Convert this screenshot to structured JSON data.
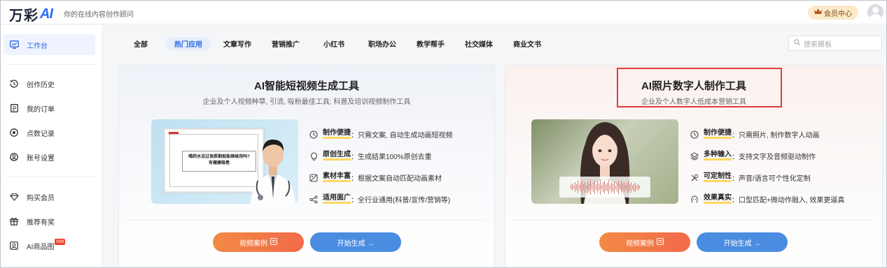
{
  "header": {
    "logo_text": "万彩",
    "logo_mark": "AI",
    "slogan": "你的在线内容创作顾问",
    "vip_label": "会员中心"
  },
  "sidebar": {
    "items": [
      {
        "label": "工作台",
        "icon": "monitor-chart-icon"
      },
      {
        "label": "创作历史",
        "icon": "history-icon"
      },
      {
        "label": "我的订单",
        "icon": "order-list-icon"
      },
      {
        "label": "点数记录",
        "icon": "points-record-icon"
      },
      {
        "label": "账号设置",
        "icon": "account-settings-icon"
      },
      {
        "label": "购买会员",
        "icon": "diamond-icon"
      },
      {
        "label": "推荐有奖",
        "icon": "gift-icon"
      },
      {
        "label": "AI商品图",
        "icon": "product-image-icon",
        "badge": "Hot"
      }
    ]
  },
  "tabs": [
    "全部",
    "热门应用",
    "文章写作",
    "营销推广",
    "小红书",
    "职场办公",
    "教学帮手",
    "社交媒体",
    "商业文书"
  ],
  "active_tab": "热门应用",
  "search": {
    "placeholder": "搜索模板"
  },
  "cards": [
    {
      "title": "AI智能短视频生成工具",
      "subtitle": "企业及个人视频种草, 引流, 吸粉最佳工具; 科普及培训视频制作工具",
      "thumb_caption_line1": "喝药水没过保质期就能继续用吗?",
      "thumb_caption_line2": "有健康隐患",
      "features": [
        {
          "key": "制作便捷",
          "text": "只需文案, 自动生成动画短视频",
          "icon": "clock-icon"
        },
        {
          "key": "原创生成",
          "text": "生成结果100%原创去重",
          "icon": "bulb-icon"
        },
        {
          "key": "素材丰富",
          "text": "根据文案自动匹配动画素材",
          "icon": "image-icon"
        },
        {
          "key": "适用面广",
          "text": "全行业通用(科普/宣传/营销等)",
          "icon": "share-icon"
        }
      ],
      "btn_case": "视频案例",
      "btn_start": "开始生成 →"
    },
    {
      "title": "AI照片数字人制作工具",
      "subtitle": "企业及个人数字人低成本营销工具",
      "features": [
        {
          "key": "制作便捷",
          "text": "只需照片, 制作数字人动画",
          "icon": "clock-icon"
        },
        {
          "key": "多种输入",
          "text": "支持文字及音频驱动制作",
          "icon": "layers-icon"
        },
        {
          "key": "可定制性",
          "text": "声音/语言可个性化定制",
          "icon": "tools-icon"
        },
        {
          "key": "效果真实",
          "text": "口型匹配+微动作融入, 效果更逼真",
          "icon": "face-icon"
        }
      ],
      "btn_case": "视频案例",
      "btn_start": "开始生成 →"
    }
  ],
  "colors": {
    "accent": "#2d66e6",
    "orange": "#f27a47",
    "blue": "#4a8ce0",
    "highlight": "#e23c3c"
  }
}
